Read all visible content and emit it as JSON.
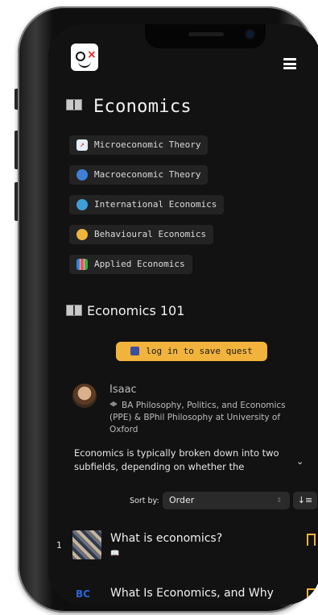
{
  "header": {
    "menu_icon": "hamburger-menu-icon"
  },
  "page": {
    "title": "Economics"
  },
  "topics": [
    {
      "label": "Microeconomic Theory",
      "icon": "chart-icon",
      "color": "#e6eef7"
    },
    {
      "label": "Macroeconomic Theory",
      "icon": "globe-icon",
      "color": "#3f7fd6"
    },
    {
      "label": "International Economics",
      "icon": "globe-icon",
      "color": "#3f9fd6"
    },
    {
      "label": "Behavioural Economics",
      "icon": "face-icon",
      "color": "#f2b33d"
    },
    {
      "label": "Applied Economics",
      "icon": "bar-chart-icon",
      "color": "#c9c9c9"
    }
  ],
  "quest": {
    "title": "Economics 101",
    "save_label": "log in to save quest"
  },
  "author": {
    "name": "Isaac",
    "bio": "BA Philosophy, Politics, and Economics (PPE) & BPhil Philosophy at University of Oxford"
  },
  "description": "Economics is typically broken down into two subfields, depending on whether the",
  "sort": {
    "label": "Sort by:",
    "value": "Order"
  },
  "items": [
    {
      "num": "1",
      "title": "What is economics?",
      "subtitle": "📖"
    },
    {
      "num": "",
      "title": "What Is Economics, and Why",
      "subtitle": "BC"
    }
  ],
  "colors": {
    "accent": "#f2b33d",
    "background": "#121212"
  }
}
